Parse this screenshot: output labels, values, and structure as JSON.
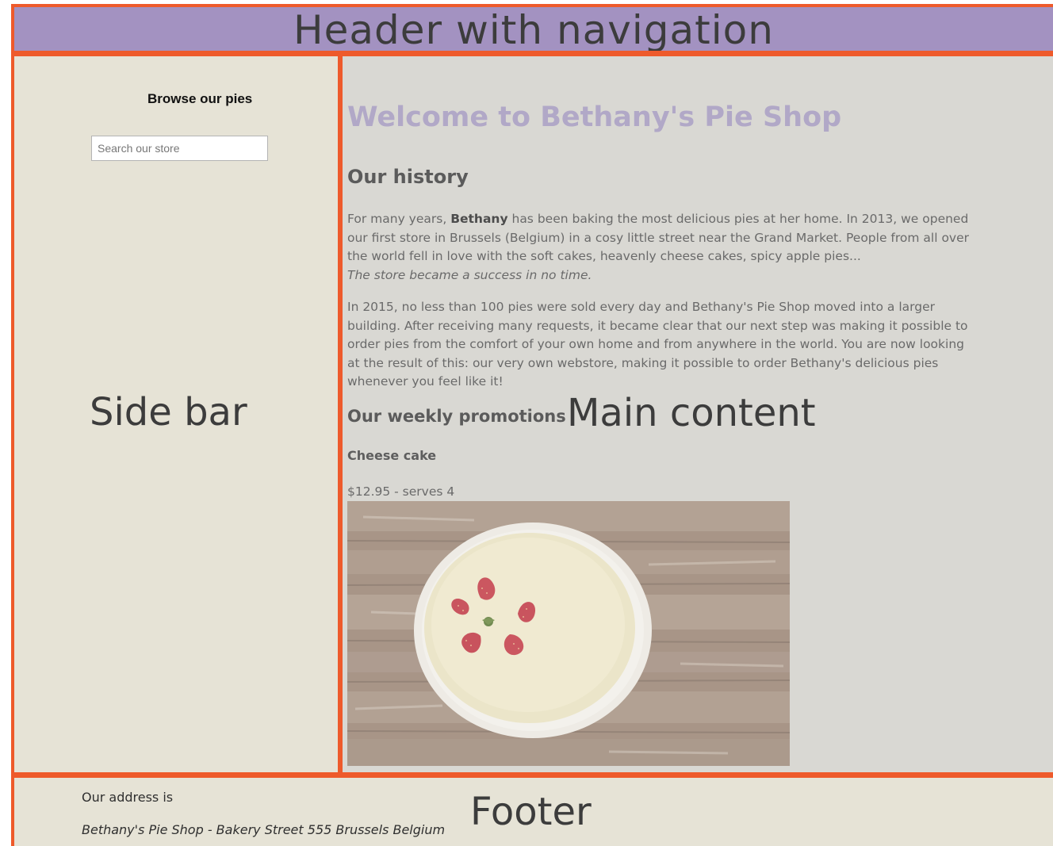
{
  "overlay_labels": {
    "header": "Header with navigation",
    "sidebar": "Side bar",
    "main": "Main content",
    "footer": "Footer"
  },
  "sidebar": {
    "title": "Browse our pies",
    "search_placeholder": "Search our store"
  },
  "main": {
    "welcome_title": "Welcome to Bethany's Pie Shop",
    "history_title": "Our history",
    "history_para1": {
      "before_bold": "For many years, ",
      "bold": "Bethany",
      "after_bold": " has been baking the most delicious pies at her home. In 2013, we opened our first store in Brussels (Belgium) in a cosy little street near the Grand Market. People from all over the world fell in love with the soft cakes, heavenly cheese cakes, spicy apple pies...",
      "italic": "The store became a success in no time."
    },
    "history_para2": "In 2015, no less than 100 pies were sold every day and Bethany's Pie Shop moved into a larger building. After receiving many requests, it became clear that our next step was making it possible to order pies from the comfort of your own home and from anywhere in the world. You are now looking at the result of this: our very own webstore, making it possible to order Bethany's delicious pies whenever you feel like it!",
    "promotions_title": "Our weekly promotions",
    "product": {
      "name": "Cheese cake",
      "price_line": "$12.95 - serves 4",
      "image": "cheesecake-with-strawberries-photo"
    }
  },
  "footer": {
    "address_label": "Our address is",
    "address": "Bethany's Pie Shop - Bakery Street 555 Brussels Belgium"
  },
  "colors": {
    "frame": "#ee5a2b",
    "header_bg": "#a392c1",
    "sidebar_bg": "#e6e3d6",
    "main_bg": "#d9d8d3",
    "welcome_text": "#b1a8c7"
  }
}
